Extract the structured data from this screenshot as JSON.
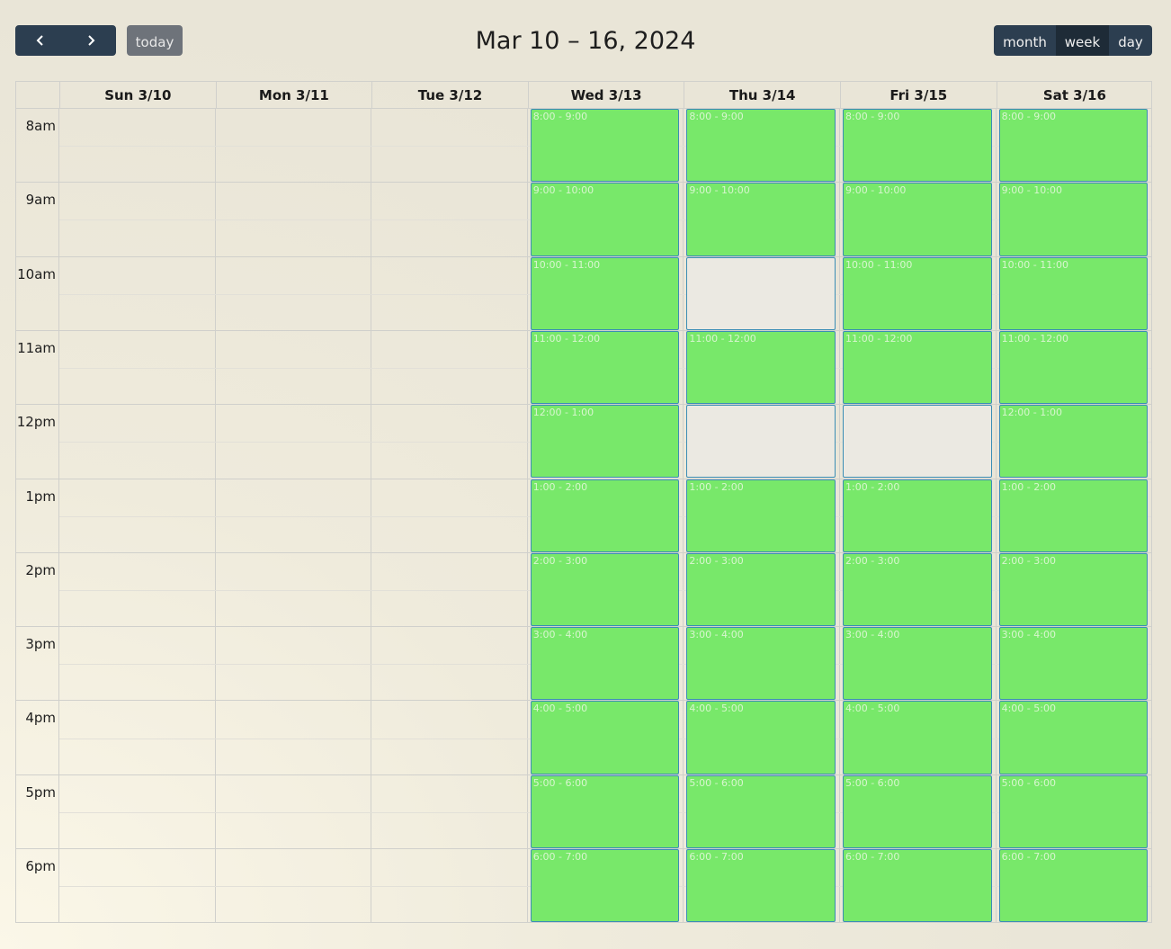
{
  "toolbar": {
    "prev_icon": "chevron-left-icon",
    "next_icon": "chevron-right-icon",
    "today_label": "today",
    "title": "Mar 10 – 16, 2024",
    "views": [
      "month",
      "week",
      "day"
    ],
    "active_view": "week"
  },
  "colors": {
    "button_dark": "#2c3e50",
    "slot_fill": "#78e86a",
    "slot_border": "#3b8db5",
    "slot_empty": "#ebe9e2"
  },
  "days": [
    "Sun 3/10",
    "Mon 3/11",
    "Tue 3/12",
    "Wed 3/13",
    "Thu 3/14",
    "Fri 3/15",
    "Sat 3/16"
  ],
  "hours": [
    "8am",
    "9am",
    "10am",
    "11am",
    "12pm",
    "1pm",
    "2pm",
    "3pm",
    "4pm",
    "5pm",
    "6pm"
  ],
  "columns": [
    {
      "day": "Wed 3/13",
      "slots": [
        {
          "label": "8:00 - 9:00"
        },
        {
          "label": "9:00 - 10:00"
        },
        {
          "label": "10:00 - 11:00"
        },
        {
          "label": "11:00 - 12:00"
        },
        {
          "label": "12:00 - 1:00"
        },
        {
          "label": "1:00 - 2:00"
        },
        {
          "label": "2:00 - 3:00"
        },
        {
          "label": "3:00 - 4:00"
        },
        {
          "label": "4:00 - 5:00"
        },
        {
          "label": "5:00 - 6:00"
        },
        {
          "label": "6:00 - 7:00"
        }
      ]
    },
    {
      "day": "Thu 3/14",
      "slots": [
        {
          "label": "8:00 - 9:00"
        },
        {
          "label": "9:00 - 10:00"
        },
        {
          "label": ""
        },
        {
          "label": "11:00 - 12:00"
        },
        {
          "label": ""
        },
        {
          "label": "1:00 - 2:00"
        },
        {
          "label": "2:00 - 3:00"
        },
        {
          "label": "3:00 - 4:00"
        },
        {
          "label": "4:00 - 5:00"
        },
        {
          "label": "5:00 - 6:00"
        },
        {
          "label": "6:00 - 7:00"
        }
      ]
    },
    {
      "day": "Fri 3/15",
      "slots": [
        {
          "label": "8:00 - 9:00"
        },
        {
          "label": "9:00 - 10:00"
        },
        {
          "label": "10:00 - 11:00"
        },
        {
          "label": "11:00 - 12:00"
        },
        {
          "label": ""
        },
        {
          "label": "1:00 - 2:00"
        },
        {
          "label": "2:00 - 3:00"
        },
        {
          "label": "3:00 - 4:00"
        },
        {
          "label": "4:00 - 5:00"
        },
        {
          "label": "5:00 - 6:00"
        },
        {
          "label": "6:00 - 7:00"
        }
      ]
    },
    {
      "day": "Sat 3/16",
      "slots": [
        {
          "label": "8:00 - 9:00"
        },
        {
          "label": "9:00 - 10:00"
        },
        {
          "label": "10:00 - 11:00"
        },
        {
          "label": "11:00 - 12:00"
        },
        {
          "label": "12:00 - 1:00"
        },
        {
          "label": "1:00 - 2:00"
        },
        {
          "label": "2:00 - 3:00"
        },
        {
          "label": "3:00 - 4:00"
        },
        {
          "label": "4:00 - 5:00"
        },
        {
          "label": "5:00 - 6:00"
        },
        {
          "label": "6:00 - 7:00"
        }
      ]
    }
  ]
}
